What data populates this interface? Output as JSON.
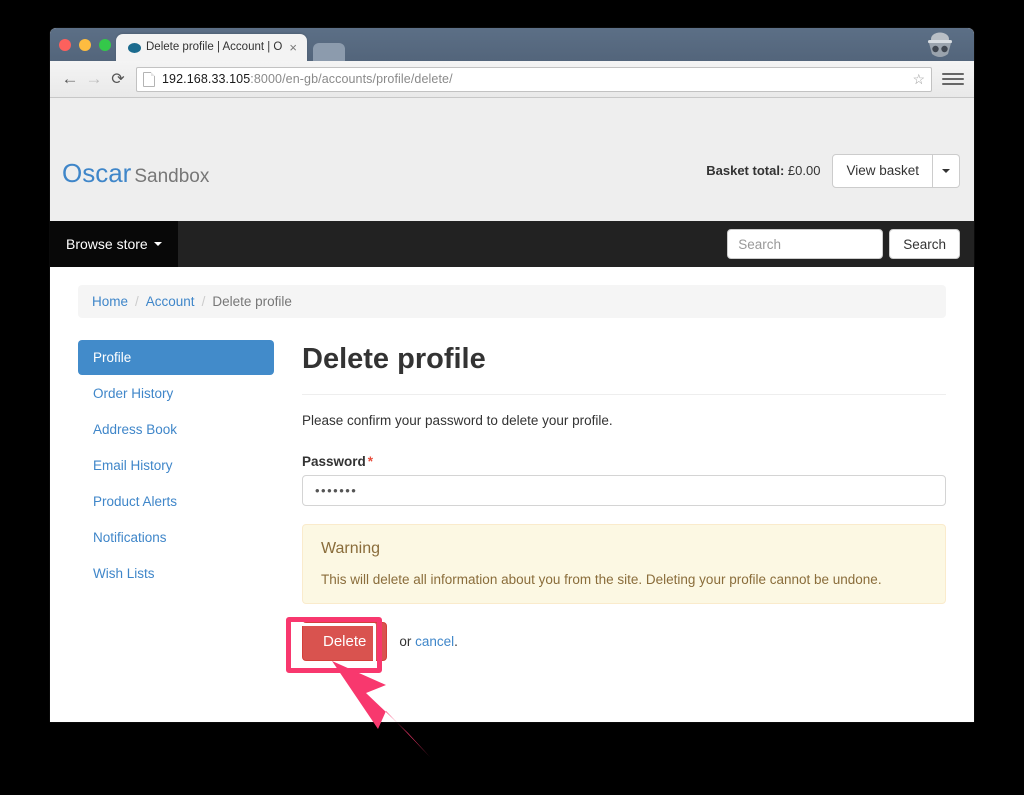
{
  "browser": {
    "tab": {
      "title": "Delete profile | Account | O",
      "favicon_name": "oscar-favicon",
      "close_label": "×"
    },
    "toolbar": {
      "back_label": "←",
      "forward_label": "→",
      "reload_label": "⟳",
      "star_label": "☆",
      "url_host": "192.168.33.105",
      "url_rest": ":8000/en-gb/accounts/profile/delete/"
    },
    "window_controls": {
      "close": "close-button",
      "minimize": "minimize-button",
      "maximize": "maximize-button"
    }
  },
  "site": {
    "brand_primary": "Oscar",
    "brand_secondary": "Sandbox",
    "basket_total_label": "Basket total:",
    "basket_total_value": "£0.00",
    "view_basket_label": "View basket",
    "browse_store_label": "Browse store",
    "search_placeholder": "Search",
    "search_value": "",
    "search_button_label": "Search"
  },
  "breadcrumb": {
    "home": "Home",
    "account": "Account",
    "current": "Delete profile",
    "separator": "/"
  },
  "sidebar": {
    "items": [
      {
        "label": "Profile",
        "active": true
      },
      {
        "label": "Order History",
        "active": false
      },
      {
        "label": "Address Book",
        "active": false
      },
      {
        "label": "Email History",
        "active": false
      },
      {
        "label": "Product Alerts",
        "active": false
      },
      {
        "label": "Notifications",
        "active": false
      },
      {
        "label": "Wish Lists",
        "active": false
      }
    ]
  },
  "main": {
    "title": "Delete profile",
    "intro": "Please confirm your password to delete your profile.",
    "form": {
      "password_label": "Password",
      "required_marker": "*",
      "password_value": "•••••••",
      "password_placeholder": ""
    },
    "warning": {
      "title": "Warning",
      "text": "This will delete all information about you from the site. Deleting your profile cannot be undone."
    },
    "actions": {
      "delete_label": "Delete",
      "or_text": "or ",
      "cancel_label": "cancel",
      "trailing_period": "."
    }
  },
  "colors": {
    "brand_blue": "#3f86c9",
    "sidebar_active": "#428bca",
    "danger": "#d9534f",
    "warning_bg": "#fcf8e3",
    "warning_text": "#8a6d3b",
    "annotation_pink": "#f8386e",
    "navbar_dark": "#222222",
    "page_bg": "#eeeeee"
  }
}
